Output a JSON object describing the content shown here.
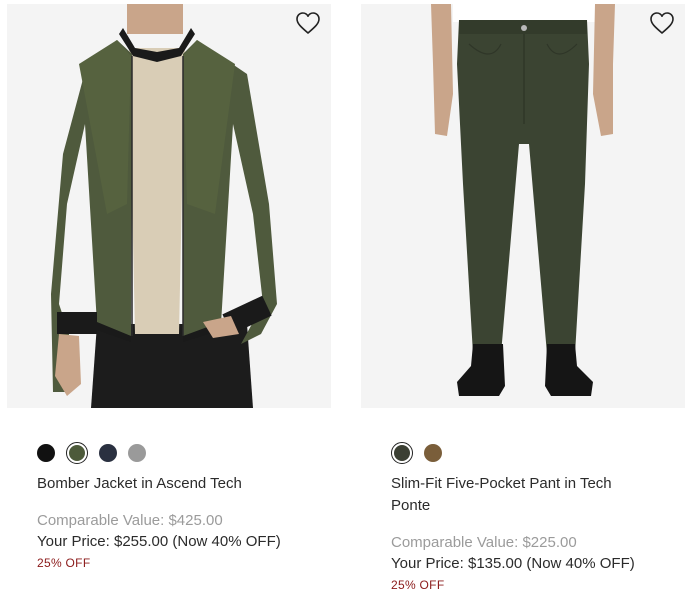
{
  "colors": {
    "discount": "#8b1a1a",
    "muted_text": "#9b9b9b",
    "image_bg": "#f4f4f4"
  },
  "products": [
    {
      "name": "Bomber Jacket in Ascend Tech",
      "comparable_value": "Comparable Value: $425.00",
      "your_price": "Your Price: $255.00 (Now 40% OFF)",
      "discount": "25% OFF",
      "wishlist_icon": "heart-outline-icon",
      "swatches": [
        {
          "color": "#111111",
          "selected": false
        },
        {
          "color": "#4d5a3a",
          "selected": true
        },
        {
          "color": "#2a3040",
          "selected": false
        },
        {
          "color": "#9a9a9a",
          "selected": false
        }
      ]
    },
    {
      "name": "Slim-Fit Five-Pocket Pant in Tech Ponte",
      "comparable_value": "Comparable Value: $225.00",
      "your_price": "Your Price: $135.00 (Now 40% OFF)",
      "discount": "25% OFF",
      "wishlist_icon": "heart-outline-icon",
      "swatches": [
        {
          "color": "#3b3f33",
          "selected": true
        },
        {
          "color": "#7a5e3a",
          "selected": false
        }
      ]
    }
  ]
}
